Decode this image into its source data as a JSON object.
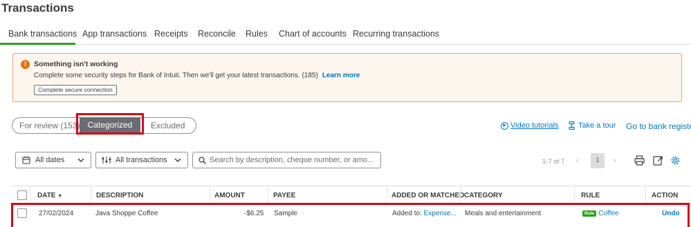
{
  "page": {
    "title": "Transactions"
  },
  "nav_tabs": [
    {
      "label": "Bank transactions",
      "active": true
    },
    {
      "label": "App transactions"
    },
    {
      "label": "Receipts"
    },
    {
      "label": "Reconcile"
    },
    {
      "label": "Rules"
    },
    {
      "label": "Chart of accounts"
    },
    {
      "label": "Recurring transactions"
    }
  ],
  "alert": {
    "icon": "alert-icon",
    "title": "Something isn't working",
    "message": "Complete some security steps for Bank of Intuit. Then we'll get your latest transactions. (185)",
    "link": "Learn more",
    "button": "Complete secure connection"
  },
  "segments": {
    "for_review": "For review (153)",
    "categorized": "Categorized",
    "excluded": "Excluded"
  },
  "links": {
    "video": "Video tutorials",
    "tour": "Take a tour",
    "go_bank": "Go to bank register"
  },
  "filters": {
    "dates": "All dates",
    "transactions": "All transactions",
    "search_placeholder": "Search by description, cheque number, or amo..."
  },
  "pagination": {
    "range": "1-7 of 7",
    "current_page": "1",
    "prev": "‹",
    "next": "›"
  },
  "table": {
    "columns": {
      "date": "DATE",
      "sort_indicator": "▼",
      "description": "DESCRIPTION",
      "amount": "AMOUNT",
      "payee": "PAYEE",
      "added_or_matched": "ADDED OR MATCHED",
      "category": "CATEGORY",
      "rule": "RULE",
      "action": "ACTION"
    },
    "rows": [
      {
        "date": "27/02/2024",
        "description": "Java Shoppe Coffee",
        "amount": "-$6.25",
        "payee": "Sample",
        "added_prefix": "Added to:",
        "added_link": "Expense...",
        "category": "Meals and entertainment",
        "rule_badge": "Rule",
        "rule": "Coffee",
        "action": "Undo"
      }
    ]
  },
  "colors": {
    "accent_green": "#2ca01c",
    "link_blue": "#0077c5",
    "highlight_red": "#d0021b",
    "alert_orange": "#e8710a"
  }
}
